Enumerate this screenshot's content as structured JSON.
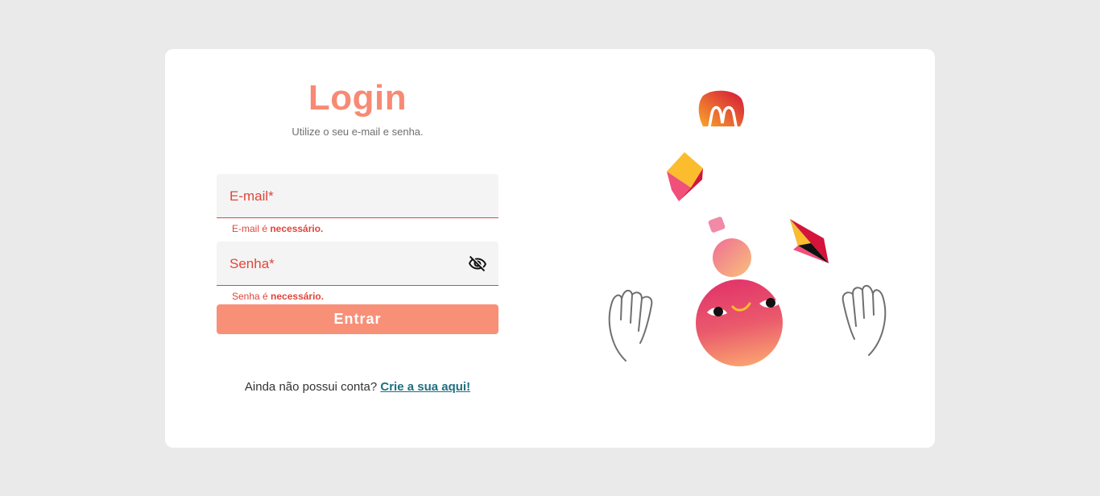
{
  "login": {
    "title": "Login",
    "subtitle": "Utilize o seu e-mail e senha.",
    "email": {
      "label": "E-mail*",
      "value": "",
      "error_prefix": "E-mail é ",
      "error_bold": "necessário."
    },
    "password": {
      "label": "Senha*",
      "value": "",
      "error_prefix": "Senha é ",
      "error_bold": "necessário.",
      "visibility_icon": "eye-off-icon"
    },
    "submit_label": "Entrar",
    "signup_prompt": "Ainda não possui conta? ",
    "signup_link": "Crie a sua aqui!"
  },
  "colors": {
    "background": "#eaeaea",
    "accent": "#f78a75",
    "button": "#f89078",
    "error": "#e0463a",
    "link": "#1e6f80"
  }
}
